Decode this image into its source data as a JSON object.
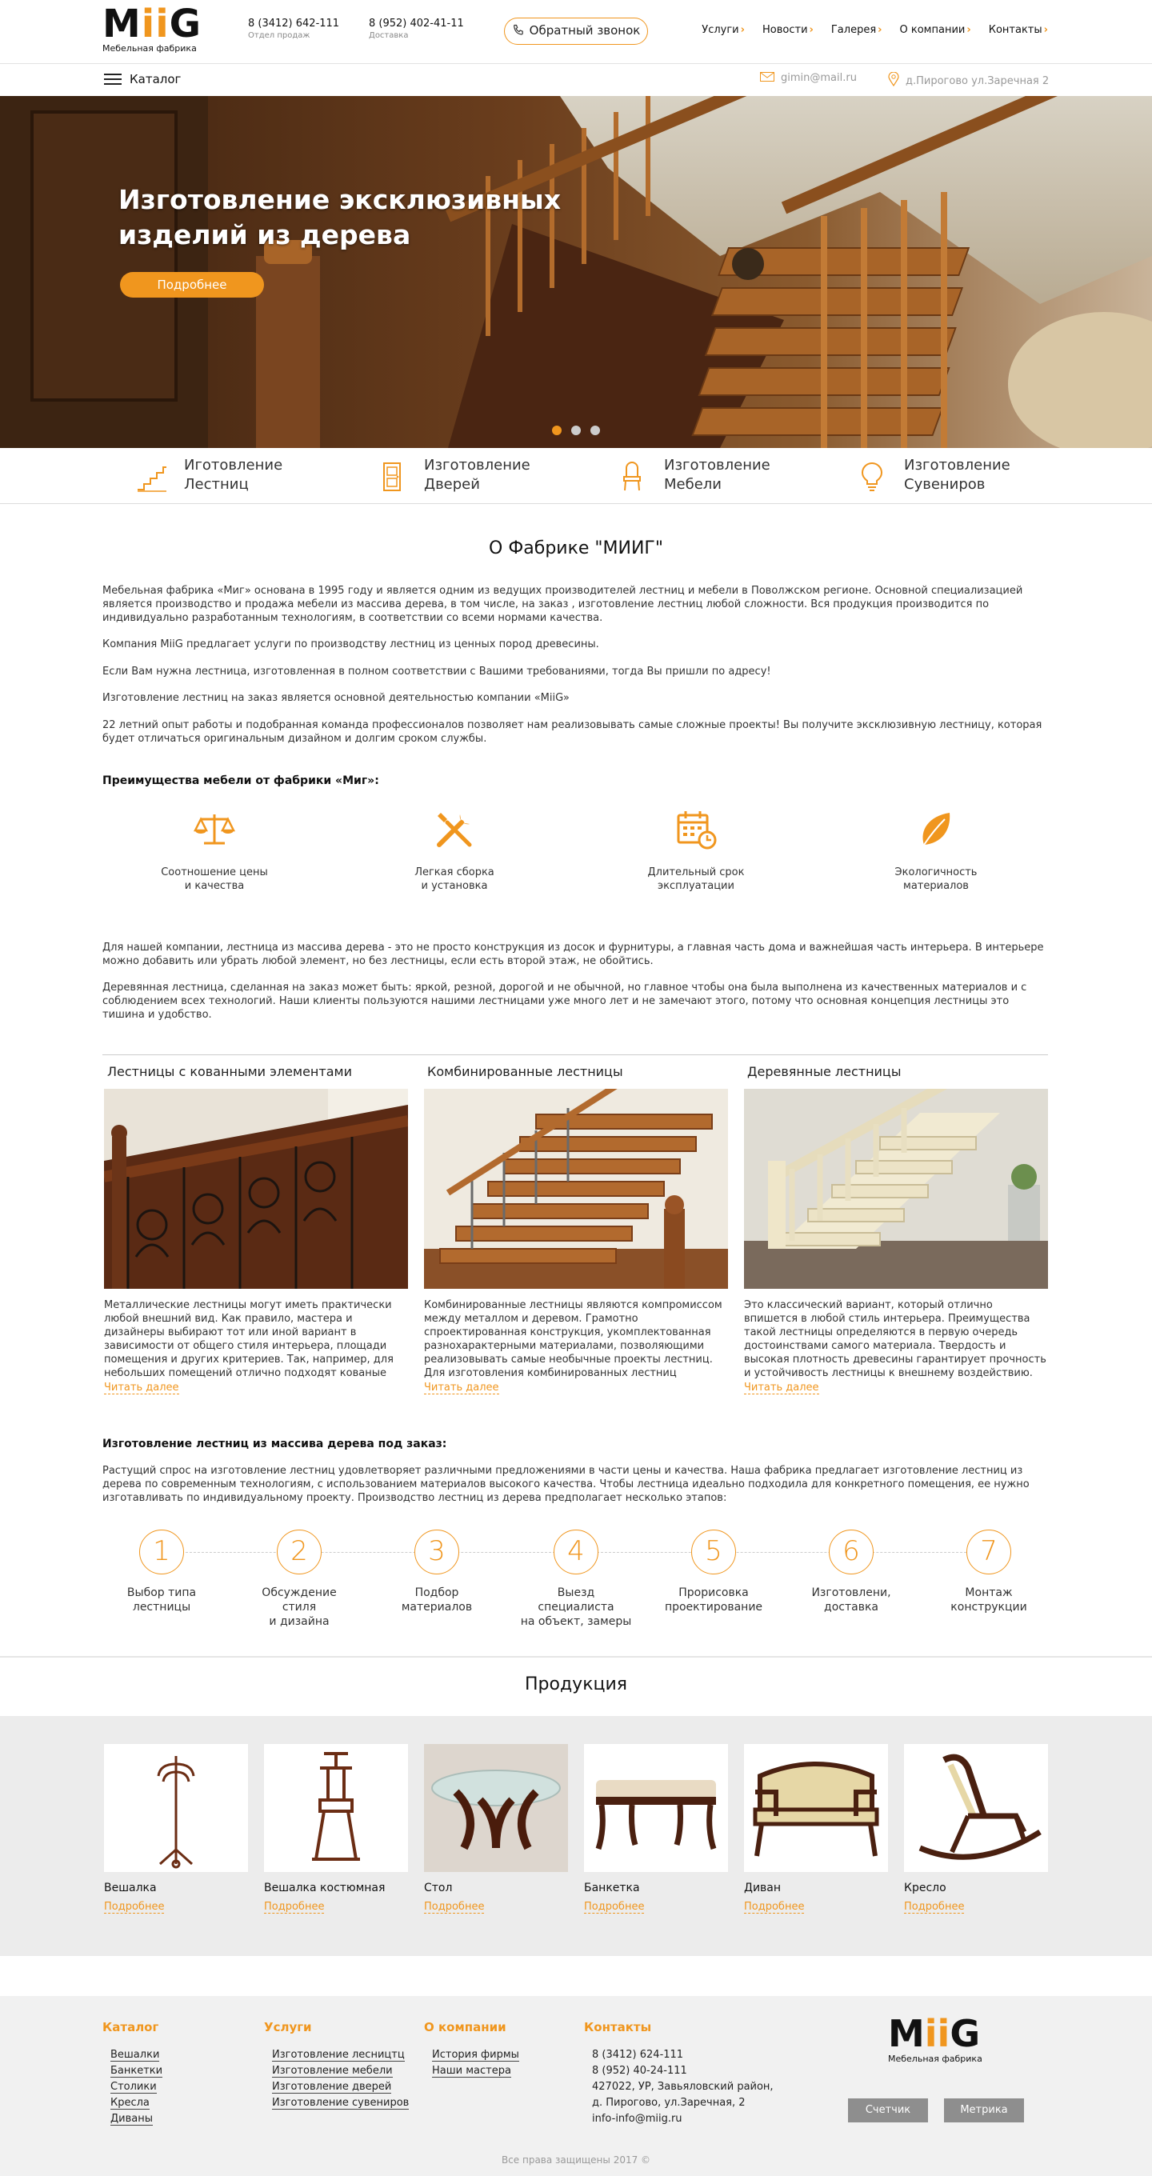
{
  "header": {
    "logo_text_a": "M",
    "logo_text_ii": "ii",
    "logo_text_b": "G",
    "logo_sub": "Мебельная фабрика",
    "phone1": "8 (3412) 642-111",
    "phone1_cap": "Отдел продаж",
    "phone2": "8 (952) 402-41-11",
    "phone2_cap": "Доставка",
    "callback": "Обратный звонок",
    "nav": [
      "Услуги",
      "Новости",
      "Галерея",
      "О компании",
      "Контакты"
    ],
    "catalog": "Каталог",
    "email": "gimin@mail.ru",
    "address": "д.Пирогово ул.Заречная 2"
  },
  "hero": {
    "title": "Изготовление эксклюзивных изделий из дерева",
    "button": "Подробнее",
    "slides": 3,
    "active_slide": 1
  },
  "services": [
    {
      "label": "Иготовление Лестниц",
      "icon": "stairs-icon"
    },
    {
      "label": "Изготовление Дверей",
      "icon": "door-icon"
    },
    {
      "label": "Изготовление Мебели",
      "icon": "chair-icon"
    },
    {
      "label": "Изготовление Сувениров",
      "icon": "lightbulb-icon"
    }
  ],
  "about": {
    "title": "О Фабрике \"МИИГ\"",
    "paragraphs": [
      "Мебельная фабрика «Миг» основана в 1995 году и является одним из ведущих производителей лестниц и мебели в Поволжском регионе. Основной специализацией является производство и продажа мебели из массива дерева, в том числе, на заказ , изготовление лестниц любой сложности. Вся продукция производится по индивидуально разработанным технологиям, в соответствии со всеми нормами качества.",
      "Компания MiiG предлагает услуги по производству лестниц из ценных пород древесины.",
      "Если Вам  нужна лестница, изготовленная в полном соответствии с Вашими требованиями, тогда Вы пришли по адресу!",
      "Изготовление лестниц на заказ является основной деятельностью компании «MiiG»",
      "22 летний опыт работы и подобранная команда профессионалов позволяет нам реализовывать самые сложные проекты! Вы получите эксклюзивную лестницу, которая будет отличаться оригинальным дизайном и долгим сроком службы."
    ],
    "advantages_title": "Преимущества мебели от фабрики «Миг»:",
    "advantages": [
      {
        "label": "Соотношение цены\nи качества",
        "icon": "scales-icon"
      },
      {
        "label": "Легкая сборка\nи установка",
        "icon": "tools-icon"
      },
      {
        "label": "Длительный срок\nэксплуатации",
        "icon": "calendar-clock-icon"
      },
      {
        "label": "Экологичность\nматериалов",
        "icon": "leaf-icon"
      }
    ],
    "text2": [
      "Для нашей компании, лестница из массива   дерева -   это не   просто конструкция   из    досок и фурнитуры, а главная часть дома и важнейшая часть интерьера.  В интерьере можно добавить или убрать любой элемент, но без лестницы, если есть второй этаж, не обойтись.",
      "Деревянная лестница, сделанная на заказ может быть: яркой, резной, дорогой и не обычной, но главное чтобы она была выполнена из качественных материалов и с соблюдением всех технологий. Наши  клиенты пользуются нашими лестницами уже много лет и не замечают этого, потому что основная концепция лестницы это тишина и удобство."
    ]
  },
  "stairs": [
    {
      "title": "Лестницы с кованными элементами",
      "desc": "Металлические лестницы могут иметь практически любой внешний вид. Как правило, мастера и дизайнеры выбирают тот или иной вариант в зависимости от общего стиля интерьера, площади помещения и других критериев. Так, например, для небольших помещений отлично подходят кованые",
      "more": "Читать далее"
    },
    {
      "title": "Комбинированные лестницы",
      "desc": "Комбинированные лестницы являются компромиссом между металлом и деревом. Грамотно спроектированная конструкция, укомплектованная разнохарактерными материалами, позволяющими реализовывать самые необычные проекты лестниц. Для изготовления комбинированных лестниц",
      "more": "Читать далее"
    },
    {
      "title": "Деревянные лестницы",
      "desc": "Это классический вариант, который отлично впишется в любой стиль интерьера. Преимущества такой лестницы определяются в первую очередь достоинствами самого материала. Твердость и высокая плотность древесины гарантирует прочность и устойчивость лестницы к внешнему воздействию.",
      "more": "Читать далее"
    }
  ],
  "process": {
    "title": "Изготовление лестниц из массива дерева под заказ:",
    "text": "Растущий спрос на изготовление лестниц удовлетворяет различными предложениями в части цены и качества. Наша фабрика предлагает изготовление лестниц из дерева по современным технологиям, с использованием материалов высокого качества. Чтобы лестница идеально подходила для конкретного помещения, ее нужно изготавливать по индивидуальному проекту. Производство лестниц из дерева предполагает несколько этапов:",
    "steps": [
      {
        "n": "1",
        "label": "Выбор типа\nлестницы"
      },
      {
        "n": "2",
        "label": "Обсуждение стиля\nи дизайна"
      },
      {
        "n": "3",
        "label": "Подбор\nматериалов"
      },
      {
        "n": "4",
        "label": "Выезд специалиста\nна объект, замеры"
      },
      {
        "n": "5",
        "label": "Прорисовка\nпроектирование"
      },
      {
        "n": "6",
        "label": "Изготовлени,\nдоставка"
      },
      {
        "n": "7",
        "label": "Монтаж\nконструкции"
      }
    ]
  },
  "products": {
    "title": "Продукция",
    "items": [
      {
        "name": "Вешалка",
        "more": "Подробнее"
      },
      {
        "name": "Вешалка костюмная",
        "more": "Подробнее"
      },
      {
        "name": "Стол",
        "more": "Подробнее"
      },
      {
        "name": "Банкетка",
        "more": "Подробнее"
      },
      {
        "name": "Диван",
        "more": "Подробнее"
      },
      {
        "name": "Кресло",
        "more": "Подробнее"
      }
    ]
  },
  "footer": {
    "catalog_title": "Каталог",
    "catalog": [
      "Вешалки",
      "Банкетки",
      "Столики",
      "Кресла",
      "Диваны"
    ],
    "services_title": "Услуги",
    "services": [
      "Изготовление лесництц",
      "Изготовление мебели",
      "Изготовление дверей",
      "Изготовление сувениров"
    ],
    "company_title": "О компании",
    "company": [
      "История фирмы",
      "Наши мастера"
    ],
    "contacts_title": "Контакты",
    "contacts": [
      "8 (3412) 624-111",
      "8 (952) 40-24-111",
      "427022, УР, Завьяловский район,",
      "д. Пирогово, ул.Заречная, 2"
    ],
    "contact_email": "info-info@miig.ru",
    "btn_counter": "Счетчик",
    "btn_metrika": "Метрика",
    "copyright": "Все права защищены 2017 ©"
  },
  "colors": {
    "accent": "#f0961e",
    "footer_bg": "#f1f1f1",
    "button_gray": "#8e8e8e"
  }
}
